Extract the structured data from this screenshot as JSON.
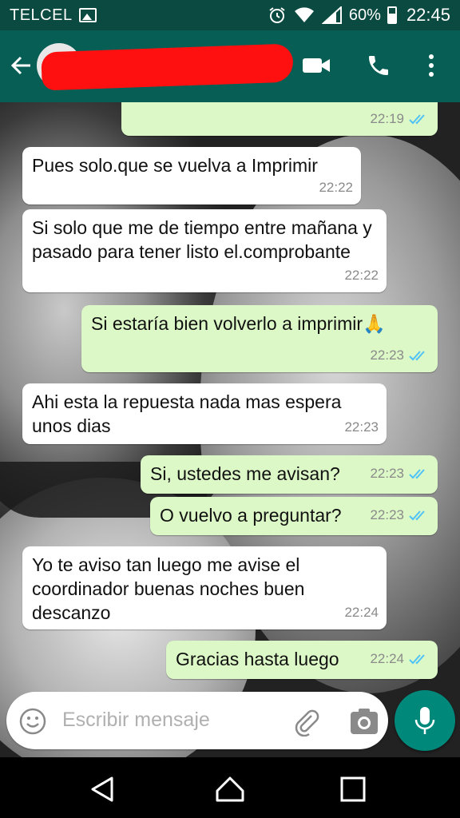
{
  "status_bar": {
    "carrier": "TELCEL",
    "battery_percent": "60%",
    "time": "22:45"
  },
  "header": {
    "contact_name_redacted": true
  },
  "colors": {
    "header_bg": "#075e54",
    "status_bg": "#0a4a40",
    "outgoing_bubble": "#dcf8c6",
    "incoming_bubble": "#ffffff",
    "read_ticks": "#4fc3f7",
    "mic_button": "#00897b"
  },
  "messages": [
    {
      "direction": "out",
      "text": "",
      "time": "22:19",
      "read": true
    },
    {
      "direction": "in",
      "text": "Pues solo.que se vuelva a Imprimir",
      "time": "22:22"
    },
    {
      "direction": "in",
      "text": "Si solo que me de tiempo entre mañana y pasado para tener listo el.comprobante",
      "time": "22:22"
    },
    {
      "direction": "out",
      "text": "Si estaría bien volverlo a imprimir🙏",
      "time": "22:23",
      "read": true
    },
    {
      "direction": "in",
      "text": "Ahi esta la repuesta nada mas espera unos dias",
      "time": "22:23"
    },
    {
      "direction": "out",
      "text": "Si, ustedes me avisan?",
      "time": "22:23",
      "read": true
    },
    {
      "direction": "out",
      "text": "O vuelvo a preguntar?",
      "time": "22:23",
      "read": true
    },
    {
      "direction": "in",
      "text": "Yo te aviso tan luego me avise el coordinador buenas noches buen descanzo",
      "time": "22:24"
    },
    {
      "direction": "out",
      "text": "Gracias hasta luego",
      "time": "22:24",
      "read": true
    }
  ],
  "composer": {
    "placeholder": "Escribir mensaje"
  },
  "icons": {
    "header": [
      "back-arrow-icon",
      "avatar",
      "video-call-icon",
      "phone-call-icon",
      "more-vert-icon"
    ],
    "composer": [
      "emoji-icon",
      "attach-icon",
      "camera-icon",
      "mic-icon"
    ],
    "navbar": [
      "nav-back-icon",
      "nav-home-icon",
      "nav-recents-icon"
    ]
  }
}
